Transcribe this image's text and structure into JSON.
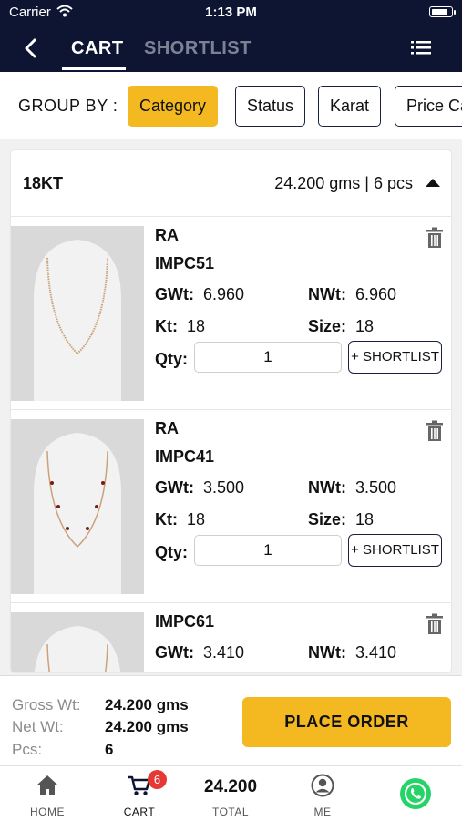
{
  "status_bar": {
    "carrier": "Carrier",
    "time": "1:13 PM"
  },
  "nav": {
    "tabs": [
      {
        "label": "CART",
        "active": true
      },
      {
        "label": "SHORTLIST",
        "active": false
      }
    ]
  },
  "group_by": {
    "label": "GROUP BY :",
    "options": [
      {
        "label": "Category",
        "active": true
      },
      {
        "label": "Status",
        "active": false
      },
      {
        "label": "Karat",
        "active": false
      },
      {
        "label": "Price Ca",
        "active": false
      }
    ]
  },
  "group": {
    "karat": "18KT",
    "summary": "24.200 gms | 6 pcs"
  },
  "items": [
    {
      "brand": "RA",
      "code": "IMPC51",
      "gwt_label": "GWt:",
      "gwt": "6.960",
      "nwt_label": "NWt:",
      "nwt": "6.960",
      "kt_label": "Kt:",
      "kt": "18",
      "size_label": "Size:",
      "size": "18",
      "qty_label": "Qty:",
      "qty": "1",
      "shortlist_label": "+ SHORTLIST"
    },
    {
      "brand": "RA",
      "code": "IMPC41",
      "gwt_label": "GWt:",
      "gwt": "3.500",
      "nwt_label": "NWt:",
      "nwt": "3.500",
      "kt_label": "Kt:",
      "kt": "18",
      "size_label": "Size:",
      "size": "18",
      "qty_label": "Qty:",
      "qty": "1",
      "shortlist_label": "+ SHORTLIST"
    },
    {
      "brand": "",
      "code": "IMPC61",
      "gwt_label": "GWt:",
      "gwt": "3.410",
      "nwt_label": "NWt:",
      "nwt": "3.410"
    }
  ],
  "footer": {
    "gross_label": "Gross Wt:",
    "gross_value": "24.200 gms",
    "net_label": "Net Wt:",
    "net_value": "24.200 gms",
    "pcs_label": "Pcs:",
    "pcs_value": "6",
    "place_order_label": "PLACE ORDER"
  },
  "tabbar": {
    "home_label": "HOME",
    "cart_label": "CART",
    "cart_badge": "6",
    "total_value": "24.200",
    "total_label": "TOTAL",
    "me_label": "ME"
  },
  "colors": {
    "navy": "#0d1533",
    "accent": "#f4b921",
    "badge": "#e53935",
    "whatsapp": "#25d366"
  },
  "icons": [
    "back-arrow-icon",
    "menu-icon",
    "trash-icon",
    "home-icon",
    "cart-icon",
    "profile-icon",
    "whatsapp-icon",
    "wifi-icon",
    "battery-icon",
    "caret-up-icon"
  ]
}
